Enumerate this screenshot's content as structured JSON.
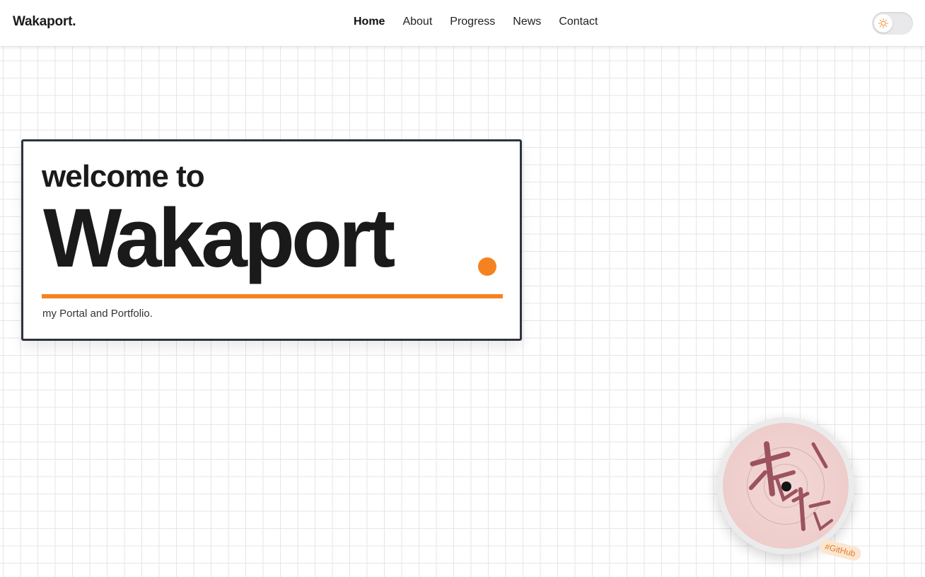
{
  "brand": "Wakaport.",
  "nav": {
    "items": [
      {
        "label": "Home",
        "active": true
      },
      {
        "label": "About",
        "active": false
      },
      {
        "label": "Progress",
        "active": false
      },
      {
        "label": "News",
        "active": false
      },
      {
        "label": "Contact",
        "active": false
      }
    ]
  },
  "theme_toggle": {
    "icon": "sun-icon",
    "state": "light"
  },
  "hero": {
    "greeting": "welcome to",
    "title": "Wakaport",
    "tagline": "my Portal and Portfolio."
  },
  "disc": {
    "tag": "#GitHub",
    "icon": "avatar-disc"
  },
  "colors": {
    "accent": "#f58220",
    "border": "#2c3240",
    "grid": "#e6e6e8"
  }
}
